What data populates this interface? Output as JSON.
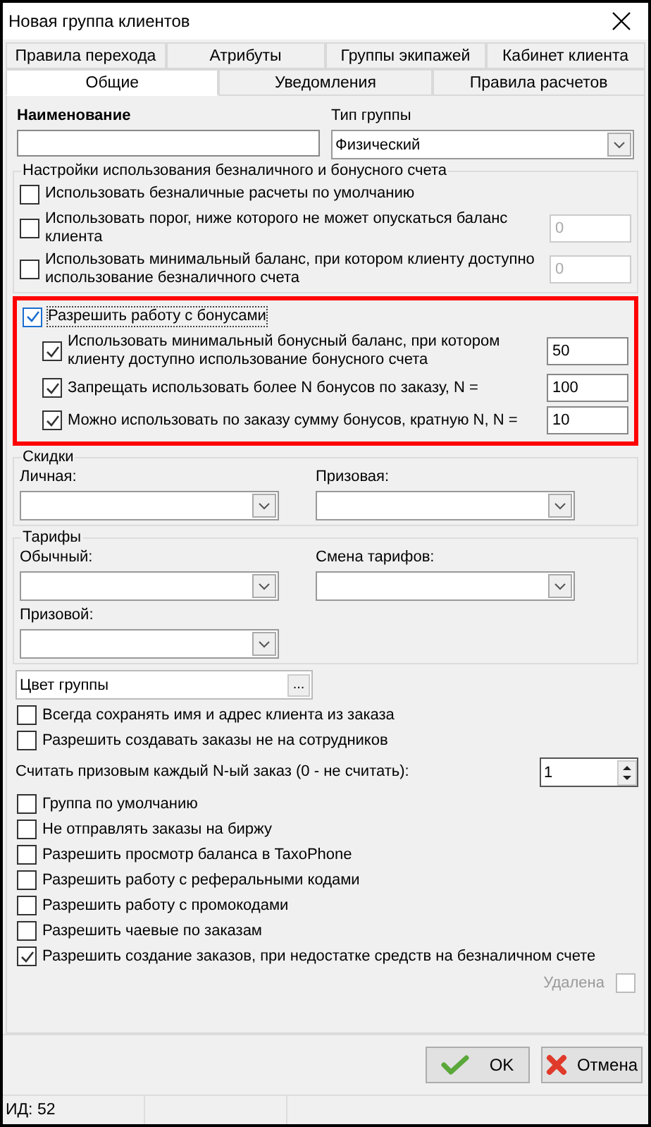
{
  "window": {
    "title": "Новая группа клиентов"
  },
  "tab_rows": [
    [
      {
        "label": "Правила перехода",
        "selected": false
      },
      {
        "label": "Атрибуты",
        "selected": false
      },
      {
        "label": "Группы экипажей",
        "selected": false
      },
      {
        "label": "Кабинет клиента",
        "selected": false
      }
    ],
    [
      {
        "label": "Общие",
        "selected": true
      },
      {
        "label": "Уведомления",
        "selected": false
      },
      {
        "label": "Правила расчетов",
        "selected": false
      }
    ]
  ],
  "name": {
    "label": "Наименование"
  },
  "group_type": {
    "label": "Тип группы",
    "value": "Физический"
  },
  "cashless": {
    "title": "Настройки использования безналичного и бонусного счета",
    "options": [
      {
        "label": "Использовать безналичные расчеты по умолчанию",
        "checked": false
      },
      {
        "label": "Использовать порог, ниже которого не может опускаться баланс клиента",
        "checked": false,
        "value": "0",
        "disabled": true
      },
      {
        "label": "Использовать минимальный баланс, при котором клиенту доступно использование безналичного счета",
        "checked": false,
        "value": "0",
        "disabled": true
      }
    ]
  },
  "bonus": {
    "label": "Разрешить работу с бонусами",
    "checked": true,
    "highlighted": true,
    "options": [
      {
        "label": "Использовать минимальный бонусный баланс, при котором клиенту доступно использование бонусного счета",
        "checked": true,
        "value": "50"
      },
      {
        "label": "Запрещать использовать более N бонусов по заказу, N =",
        "checked": true,
        "value": "100"
      },
      {
        "label": "Можно использовать по заказу сумму бонусов, кратную N, N =",
        "checked": true,
        "value": "10"
      }
    ]
  },
  "discounts": {
    "title": "Скидки",
    "fields": [
      {
        "label": "Личная:"
      },
      {
        "label": "Призовая:"
      }
    ]
  },
  "tariffs": {
    "title": "Тарифы",
    "fields": [
      {
        "label": "Обычный:"
      },
      {
        "label": "Смена тарифов:"
      },
      {
        "label": "Призовой:"
      }
    ]
  },
  "group_color": {
    "value": "Цвет группы",
    "button": "..."
  },
  "options_a": [
    {
      "label": "Всегда сохранять имя и адрес клиента из заказа",
      "checked": false
    },
    {
      "label": "Разрешить создавать заказы не на сотрудников",
      "checked": false
    }
  ],
  "prize_every": {
    "label": "Считать призовым каждый N-ый заказ (0 - не считать):",
    "value": "1"
  },
  "options_b": [
    {
      "label": "Группа по умолчанию",
      "checked": false
    },
    {
      "label": "Не отправлять заказы на биржу",
      "checked": false
    },
    {
      "label": "Разрешить просмотр баланса в TaxoPhone",
      "checked": false
    },
    {
      "label": "Разрешить работу с реферальными кодами",
      "checked": false
    },
    {
      "label": "Разрешить работу с промокодами",
      "checked": false
    },
    {
      "label": "Разрешить чаевые по заказам",
      "checked": false
    },
    {
      "label": "Разрешить создание заказов, при недостатке средств на безналичном счете",
      "checked": true
    }
  ],
  "deleted": {
    "label": "Удалена",
    "checked": false
  },
  "buttons": [
    {
      "label": "OK",
      "kind": "ok"
    },
    {
      "label": "Отмена",
      "kind": "cancel"
    }
  ],
  "status_bar": [
    "ИД: 52"
  ]
}
